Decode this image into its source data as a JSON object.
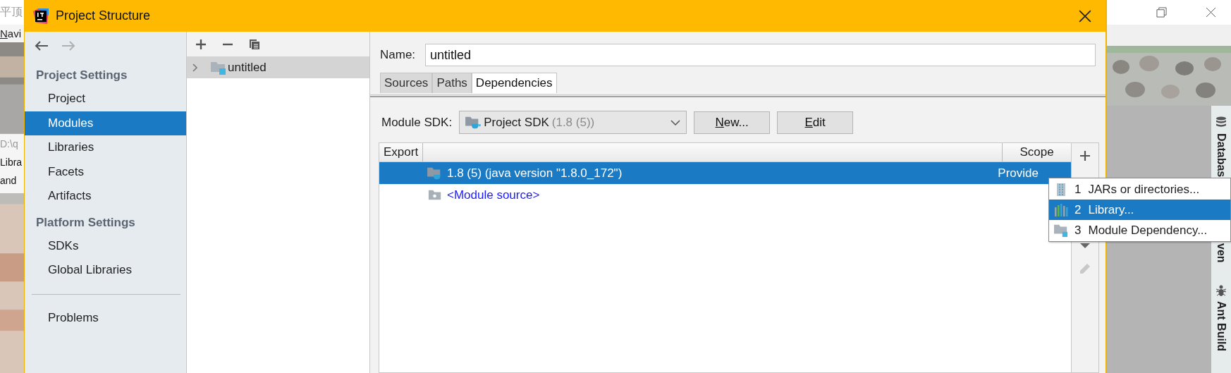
{
  "background_window": {
    "title_fragment": "平顶",
    "menu_fragment": {
      "mnemonic": "N",
      "rest": "avi"
    },
    "left_texts": [
      "D:\\q",
      "Libra",
      "and"
    ],
    "tool_windows": [
      {
        "kind": "database",
        "label": "Databas"
      },
      {
        "kind": "plain",
        "label": "ven"
      },
      {
        "kind": "ant",
        "label": "Ant Build"
      }
    ]
  },
  "window": {
    "title": "Project Structure"
  },
  "navigation": [
    {
      "kind": "back",
      "disabled": false
    },
    {
      "kind": "forward",
      "disabled": true
    }
  ],
  "sidebar": {
    "sections": [
      {
        "title": "Project Settings",
        "items": [
          {
            "label": "Project",
            "selected": false
          },
          {
            "label": "Modules",
            "selected": true
          },
          {
            "label": "Libraries",
            "selected": false
          },
          {
            "label": "Facets",
            "selected": false
          },
          {
            "label": "Artifacts",
            "selected": false
          }
        ]
      },
      {
        "title": "Platform Settings",
        "items": [
          {
            "label": "SDKs",
            "selected": false
          },
          {
            "label": "Global Libraries",
            "selected": false
          }
        ]
      }
    ],
    "footer_items": [
      {
        "label": "Problems",
        "selected": false
      }
    ]
  },
  "module_tree": {
    "items": [
      {
        "label": "untitled",
        "selected": true,
        "expanded": false
      }
    ]
  },
  "name_field": {
    "label": "Name:",
    "value": "untitled"
  },
  "tabs": [
    {
      "label": "Sources",
      "selected": false
    },
    {
      "label": "Paths",
      "selected": false
    },
    {
      "label": "Dependencies",
      "selected": true
    }
  ],
  "module_sdk": {
    "label": "Module SDK:",
    "value": "Project SDK",
    "detail": "(1.8 (5))",
    "buttons": [
      {
        "mnemonic": "N",
        "rest": "ew..."
      },
      {
        "mnemonic": "E",
        "rest": "dit"
      }
    ]
  },
  "dependencies_table": {
    "columns": [
      {
        "label": "Export"
      },
      {
        "label": "Scope"
      }
    ],
    "rows": [
      {
        "kind": "sdk",
        "label": "1.8 (5) (java version \"1.8.0_172\")",
        "scope": "Provide",
        "selected": true
      },
      {
        "kind": "module_source",
        "label": "<Module source>",
        "selected": false
      }
    ]
  },
  "add_menu": {
    "items": [
      {
        "kind": "jars",
        "number": "1",
        "label": "JARs or directories...",
        "selected": false
      },
      {
        "kind": "library",
        "number": "2",
        "label": "Library...",
        "selected": true
      },
      {
        "kind": "module",
        "number": "3",
        "label": "Module Dependency...",
        "selected": false
      }
    ]
  }
}
